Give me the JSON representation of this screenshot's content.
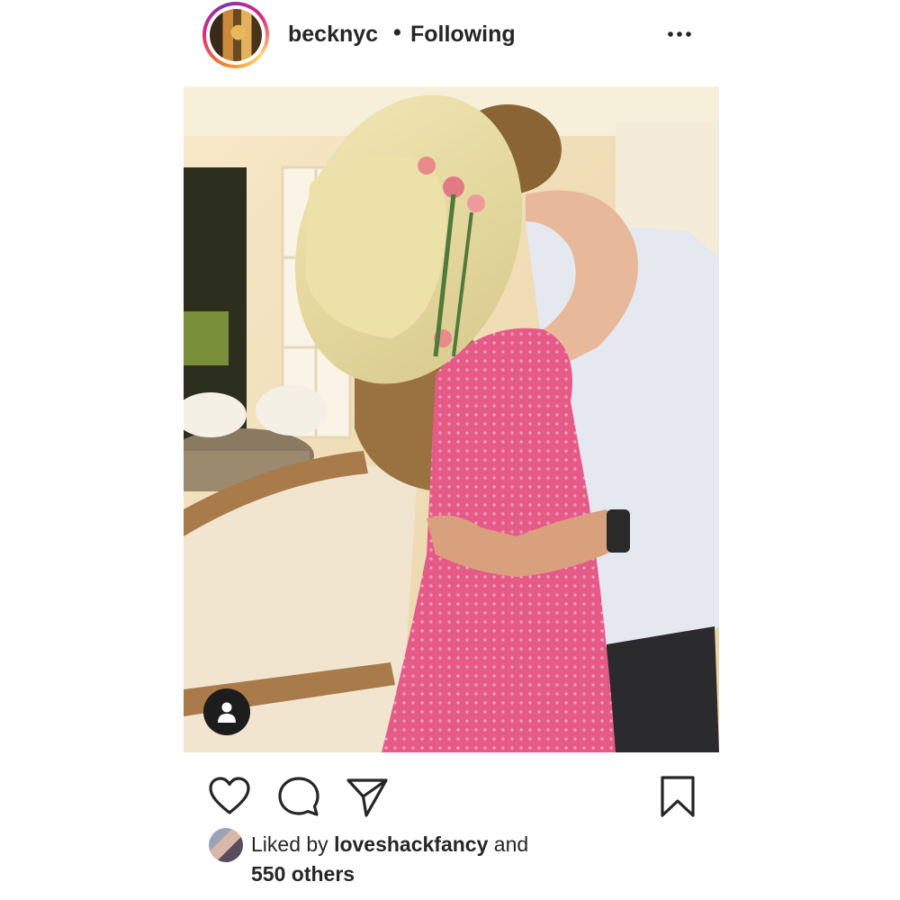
{
  "post": {
    "username": "becknyc",
    "separator": "•",
    "follow_status": "Following",
    "more_icon": "ellipsis-horizontal-icon",
    "photo_alt": "",
    "tag_icon": "person-tag-icon"
  },
  "actions": {
    "like_icon": "heart-outline-icon",
    "comment_icon": "comment-bubble-icon",
    "share_icon": "paper-plane-icon",
    "save_icon": "bookmark-outline-icon"
  },
  "likes": {
    "prefix": "Liked by ",
    "liker": "loveshackfancy",
    "connector": " and",
    "others": "550 others"
  },
  "colors": {
    "text": "#262626",
    "ring_start": "#f58529",
    "ring_mid": "#dd2a7b",
    "ring_end": "#8134af",
    "dress_pink": "#e45a86"
  }
}
